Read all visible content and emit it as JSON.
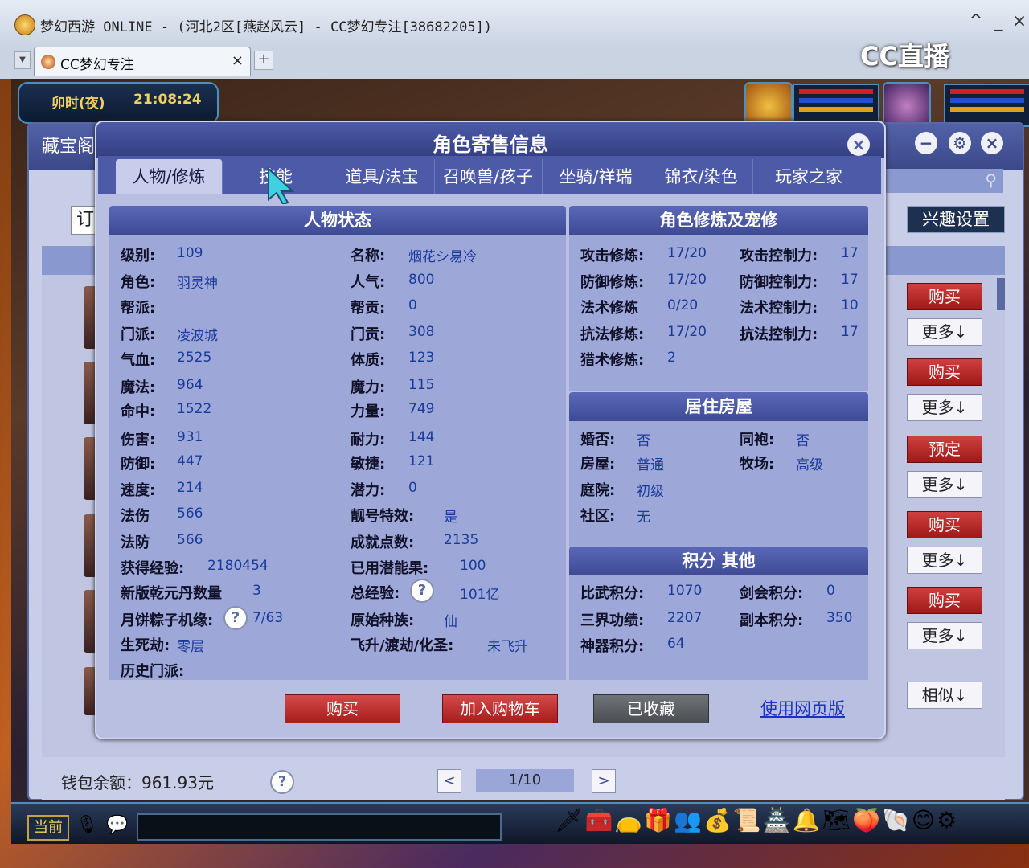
{
  "window": {
    "title": "梦幻西游 ONLINE - (河北2区[燕赵风云] - CC梦幻专注[38682205])",
    "controls": [
      "^",
      "_",
      "×"
    ],
    "brand": "CC直播"
  },
  "browser_tab": {
    "label": "CC梦幻专注",
    "close": "×",
    "new": "+"
  },
  "game_hud": {
    "time_period": "卯时(夜)",
    "clock": "21:08:24",
    "chat_channel": "当前"
  },
  "background_panel": {
    "title": "藏宝阁",
    "controls": [
      "−",
      "⚙",
      "×"
    ],
    "order_btn": "订",
    "interest_btn": "兴趣设置",
    "side_buttons": [
      {
        "label": "购买",
        "kind": "red"
      },
      {
        "label": "更多↓",
        "kind": "white"
      },
      {
        "label": "购买",
        "kind": "red"
      },
      {
        "label": "更多↓",
        "kind": "white"
      },
      {
        "label": "预定",
        "kind": "red"
      },
      {
        "label": "更多↓",
        "kind": "white"
      },
      {
        "label": "购买",
        "kind": "red"
      },
      {
        "label": "更多↓",
        "kind": "white"
      },
      {
        "label": "购买",
        "kind": "red"
      },
      {
        "label": "更多↓",
        "kind": "white"
      }
    ],
    "similar_btn": "相似↓",
    "wallet": "钱包余额：961.93元",
    "help": "?",
    "page": "1/10",
    "prev": "<",
    "next": ">"
  },
  "dialog": {
    "title": "角色寄售信息",
    "close": "×",
    "tabs": [
      "人物/修炼",
      "技能",
      "道具/法宝",
      "召唤兽/孩子",
      "坐骑/祥瑞",
      "锦衣/染色",
      "玩家之家"
    ],
    "active_tab": 0,
    "status_section": {
      "title": "人物状态",
      "col1": [
        {
          "label": "级别:",
          "value": "109"
        },
        {
          "label": "角色:",
          "value": "羽灵神"
        },
        {
          "label": "帮派:",
          "value": ""
        },
        {
          "label": "门派:",
          "value": "凌波城"
        },
        {
          "label": "气血:",
          "value": "2525"
        },
        {
          "label": "魔法:",
          "value": "964"
        },
        {
          "label": "命中:",
          "value": "1522"
        },
        {
          "label": "伤害:",
          "value": "931"
        },
        {
          "label": "防御:",
          "value": "447"
        },
        {
          "label": "速度:",
          "value": "214"
        },
        {
          "label": "法伤",
          "value": "566"
        },
        {
          "label": "法防",
          "value": "566"
        },
        {
          "label": "获得经验:",
          "value": "2180454"
        },
        {
          "label": "新版乾元丹数量",
          "value": "3"
        },
        {
          "label": "月饼粽子机缘:",
          "value": "7/63",
          "help": "?"
        },
        {
          "label": "生死劫:",
          "value": "零层"
        },
        {
          "label": "历史门派:",
          "value": ""
        }
      ],
      "col2": [
        {
          "label": "名称:",
          "value": "烟花シ易冷"
        },
        {
          "label": "人气:",
          "value": "800"
        },
        {
          "label": "帮贡:",
          "value": "0"
        },
        {
          "label": "门贡:",
          "value": "308"
        },
        {
          "label": "体质:",
          "value": "123"
        },
        {
          "label": "魔力:",
          "value": "115"
        },
        {
          "label": "力量:",
          "value": "749"
        },
        {
          "label": "耐力:",
          "value": "144"
        },
        {
          "label": "敏捷:",
          "value": "121"
        },
        {
          "label": "潜力:",
          "value": "0"
        },
        {
          "label": "靓号特效:",
          "value": "是"
        },
        {
          "label": "成就点数:",
          "value": "2135"
        },
        {
          "label": "已用潜能果:",
          "value": "100"
        },
        {
          "label": "总经验:",
          "value": "101亿",
          "help": "?"
        },
        {
          "label": "原始种族:",
          "value": "仙"
        },
        {
          "label": "飞升/渡劫/化圣:",
          "value": "未飞升"
        }
      ]
    },
    "cultivation_section": {
      "title": "角色修炼及宠修",
      "rows": [
        {
          "l1": "攻击修炼:",
          "v1": "17/20",
          "l2": "攻击控制力:",
          "v2": "17"
        },
        {
          "l1": "防御修炼:",
          "v1": "17/20",
          "l2": "防御控制力:",
          "v2": "17"
        },
        {
          "l1": "法术修炼",
          "v1": "0/20",
          "l2": "法术控制力:",
          "v2": "10"
        },
        {
          "l1": "抗法修炼:",
          "v1": "17/20",
          "l2": "抗法控制力:",
          "v2": "17"
        },
        {
          "l1": "猎术修炼:",
          "v1": "2",
          "l2": "",
          "v2": ""
        }
      ]
    },
    "housing_section": {
      "title": "居住房屋",
      "rows": [
        {
          "l1": "婚否:",
          "v1": "否",
          "l2": "同袍:",
          "v2": "否"
        },
        {
          "l1": "房屋:",
          "v1": "普通",
          "l2": "牧场:",
          "v2": "高级"
        },
        {
          "l1": "庭院:",
          "v1": "初级",
          "l2": "",
          "v2": ""
        },
        {
          "l1": "社区:",
          "v1": "无",
          "l2": "",
          "v2": ""
        }
      ]
    },
    "points_section": {
      "title": "积分 其他",
      "rows": [
        {
          "l1": "比武积分:",
          "v1": "1070",
          "l2": "剑会积分:",
          "v2": "0"
        },
        {
          "l1": "三界功绩:",
          "v1": "2207",
          "l2": "副本积分:",
          "v2": "350"
        },
        {
          "l1": "神器积分:",
          "v1": "64",
          "l2": "",
          "v2": ""
        }
      ]
    },
    "buttons": {
      "buy": "购买",
      "add_cart": "加入购物车",
      "favorited": "已收藏",
      "web": "使用网页版"
    }
  }
}
